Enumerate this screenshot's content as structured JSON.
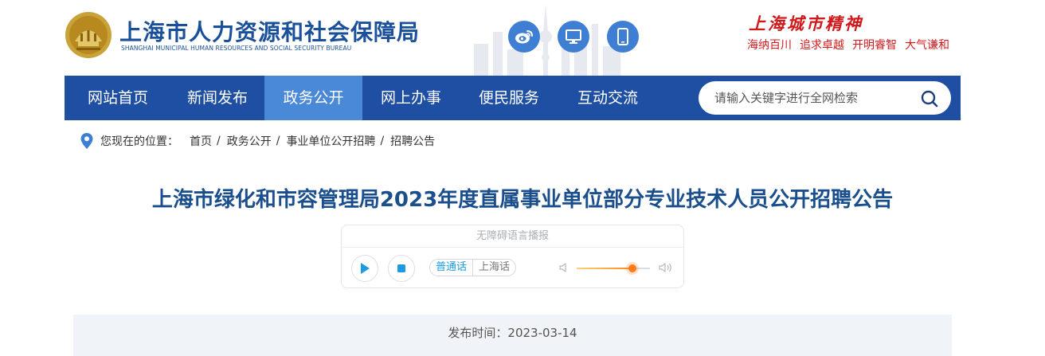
{
  "header": {
    "logo_cn": "上海市人力资源和社会保障局",
    "logo_en": "SHANGHAI MUNICIPAL HUMAN RESOURCES AND SOCIAL SECURITY BUREAU",
    "icons": [
      "weibo-icon",
      "desktop-icon",
      "mobile-icon"
    ],
    "slogan_title": "上海城市精神",
    "slogan_items": [
      "海纳百川",
      "追求卓越",
      "开明睿智",
      "大气谦和"
    ]
  },
  "nav": {
    "items": [
      {
        "label": "网站首页"
      },
      {
        "label": "新闻发布"
      },
      {
        "label": "政务公开",
        "active": true
      },
      {
        "label": "网上办事"
      },
      {
        "label": "便民服务"
      },
      {
        "label": "互动交流"
      }
    ],
    "search_placeholder": "请输入关键字进行全网检索"
  },
  "breadcrumb": {
    "lead": "您现在的位置：",
    "items": [
      "首页",
      "政务公开",
      "事业单位公开招聘",
      "招聘公告"
    ]
  },
  "article": {
    "title": "上海市绿化和市容管理局2023年度直属事业单位部分专业技术人员公开招聘公告",
    "publish_date": "发布时间：2023-03-14"
  },
  "player": {
    "header": "无障碍语言播报",
    "lang_mandarin": "普通话",
    "lang_shanghainese": "上海话",
    "volume_level": 0.76
  },
  "colors": {
    "nav_bg": "#1f4fa3",
    "nav_active": "#4a88d8",
    "title": "#1a4e8c",
    "slogan": "#d0191b"
  }
}
